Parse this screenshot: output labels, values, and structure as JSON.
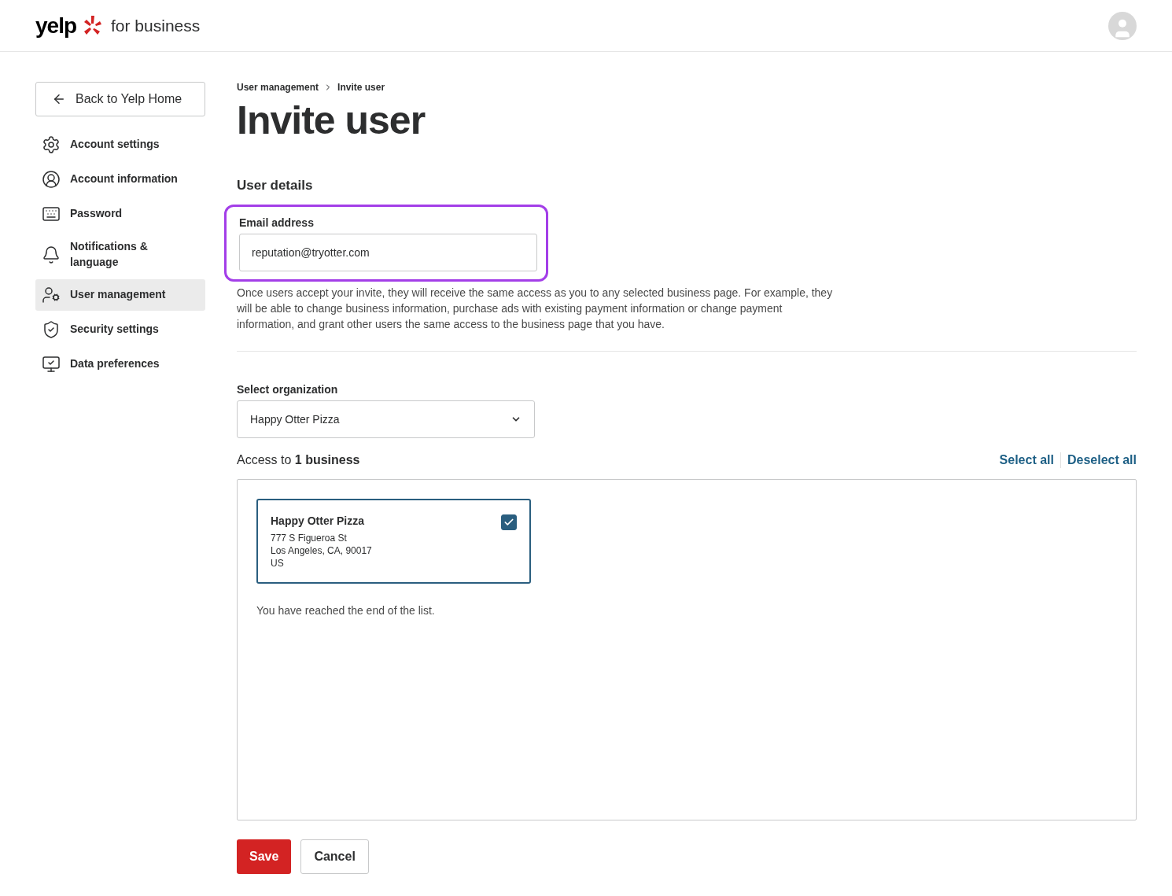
{
  "header": {
    "logo_text": "yelp",
    "logo_suffix": "for business"
  },
  "sidebar": {
    "back_button": "Back to Yelp Home",
    "items": [
      {
        "label": "Account settings",
        "selected": false
      },
      {
        "label": "Account information",
        "selected": false
      },
      {
        "label": "Password",
        "selected": false
      },
      {
        "label": "Notifications & language",
        "selected": false
      },
      {
        "label": "User management",
        "selected": true
      },
      {
        "label": "Security settings",
        "selected": false
      },
      {
        "label": "Data preferences",
        "selected": false
      }
    ]
  },
  "breadcrumb": [
    "User management",
    "Invite user"
  ],
  "title": "Invite user",
  "section_title": "User details",
  "email": {
    "label": "Email address",
    "value": "reputation@tryotter.com",
    "highlighted": true
  },
  "description": "Once users accept your invite, they will receive the same access as you to any selected business page. For example, they will be able to change business information, purchase ads with existing payment information or change payment information, and grant other users the same access to the business page that you have.",
  "organization": {
    "label": "Select organization",
    "value": "Happy Otter Pizza"
  },
  "access": {
    "heading": "Access to **1 business**",
    "select_all": "Select all",
    "deselect_all": "Deselect all"
  },
  "businesses": [
    {
      "name": "Happy Otter Pizza",
      "address": [
        "777 S Figueroa St",
        "Los Angeles, CA, 90017",
        "US"
      ],
      "checked": true
    }
  ],
  "end_message": "You have reached the end of the list.",
  "buttons": {
    "save": "Save",
    "cancel": "Cancel"
  }
}
